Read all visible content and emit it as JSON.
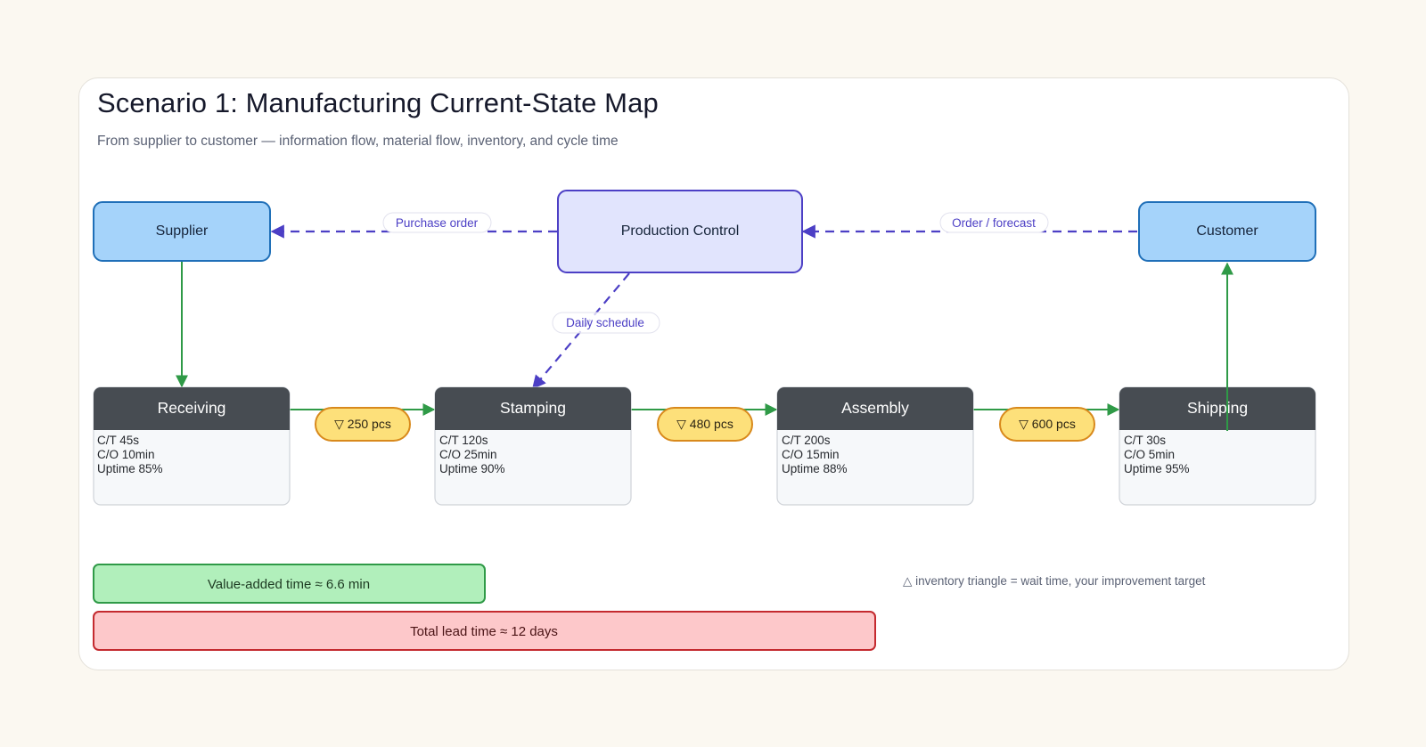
{
  "title": "Scenario 1: Manufacturing Current-State Map",
  "subtitle": "From supplier to customer — information flow, material flow, inventory, and cycle time",
  "entities": {
    "supplier": "Supplier",
    "production_control": "Production Control",
    "customer": "Customer"
  },
  "info_flows": {
    "purchase_order": "Purchase order",
    "order_forecast": "Order / forecast",
    "daily_schedule": "Daily schedule"
  },
  "processes": [
    {
      "name": "Receiving",
      "ct": "C/T 45s",
      "co": "C/O 10min",
      "uptime": "Uptime 85%"
    },
    {
      "name": "Stamping",
      "ct": "C/T 120s",
      "co": "C/O 25min",
      "uptime": "Uptime 90%"
    },
    {
      "name": "Assembly",
      "ct": "C/T 200s",
      "co": "C/O 15min",
      "uptime": "Uptime 88%"
    },
    {
      "name": "Shipping",
      "ct": "C/T 30s",
      "co": "C/O 5min",
      "uptime": "Uptime 95%"
    }
  ],
  "inventory": [
    {
      "label": "▽ 250 pcs"
    },
    {
      "label": "▽ 480 pcs"
    },
    {
      "label": "▽ 600 pcs"
    }
  ],
  "timeline": {
    "value_added": "Value-added time ≈ 6.6 min",
    "lead_time": "Total lead time ≈ 12 days"
  },
  "legend_note": "△ inventory triangle = wait time, your improvement target",
  "colors": {
    "info_flow": "#4c3fc5",
    "material_flow": "#2f9a47",
    "entity_fill": "#a5d3fa",
    "entity_stroke": "#1f6fb8",
    "control_fill": "#e1e4fd",
    "process_header": "#474c52",
    "inventory_fill": "#fde07a",
    "inventory_stroke": "#d8891c",
    "value_added_fill": "#b1efbb",
    "lead_time_fill": "#fdc8ca"
  }
}
